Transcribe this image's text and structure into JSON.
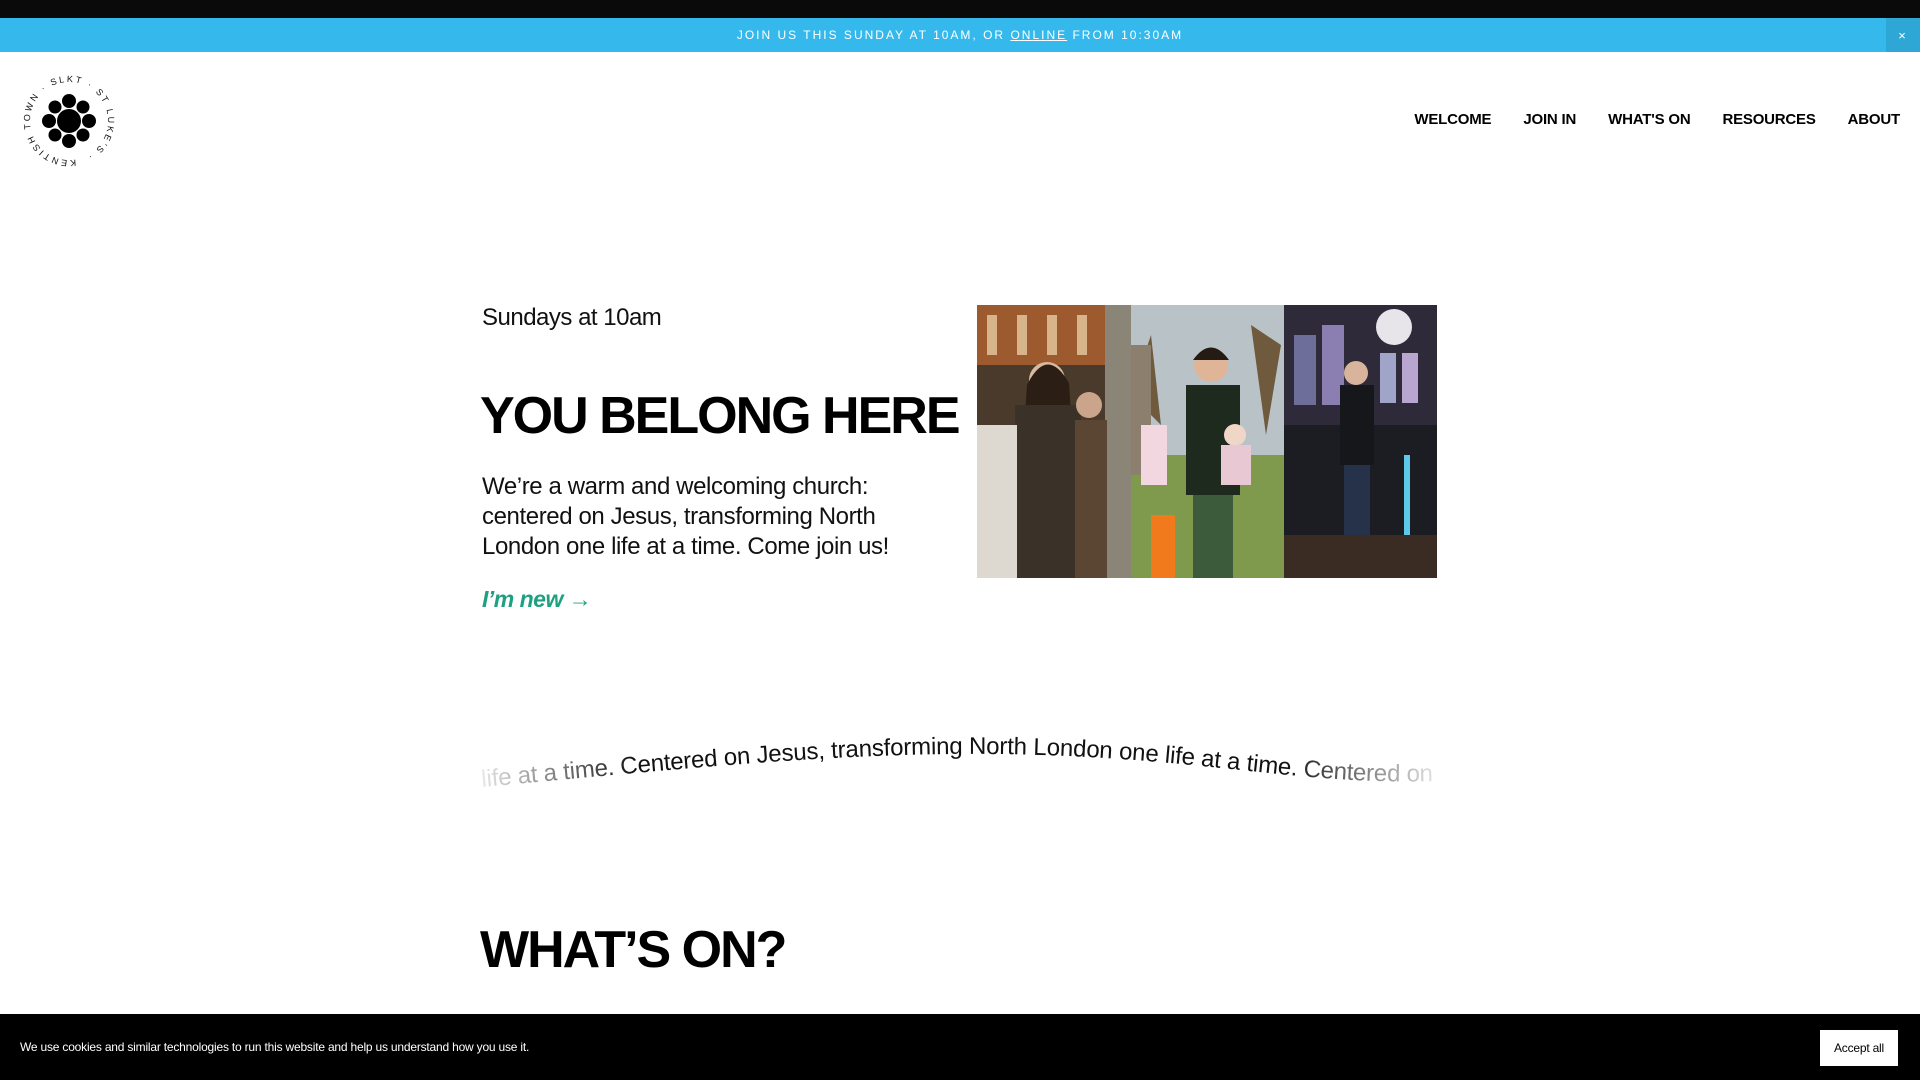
{
  "announcement": {
    "text_before": "JOIN US THIS SUNDAY AT 10AM, OR ",
    "link": "ONLINE",
    "text_after": " FROM 10:30AM",
    "close_label": "×"
  },
  "logo": {
    "ring_text": "KENTISH TOWN · SLKT · ST LUKE’S ·"
  },
  "nav": {
    "items": [
      "WELCOME",
      "JOIN IN",
      "WHAT'S ON",
      "RESOURCES",
      "ABOUT"
    ]
  },
  "hero": {
    "subtitle": "Sundays at 10am",
    "title": "YOU BELONG HERE",
    "description": "We’re a warm and welcoming church: centered on Jesus, transforming North London one life at a time. Come join us!",
    "cta": "I’m new →"
  },
  "ticker": {
    "text": "life at a time.  Centered on Jesus, transforming North London one life at a time.  Centered on Jesus"
  },
  "whats_on": {
    "title": "WHAT’S ON?"
  },
  "cookie": {
    "text": "We use cookies and similar technologies to run this website and help us understand how you use it.",
    "accept": "Accept all"
  },
  "colors": {
    "announcement_bg": "#35b9ec",
    "cta": "#1fa080",
    "cookie_bg": "#000000"
  }
}
